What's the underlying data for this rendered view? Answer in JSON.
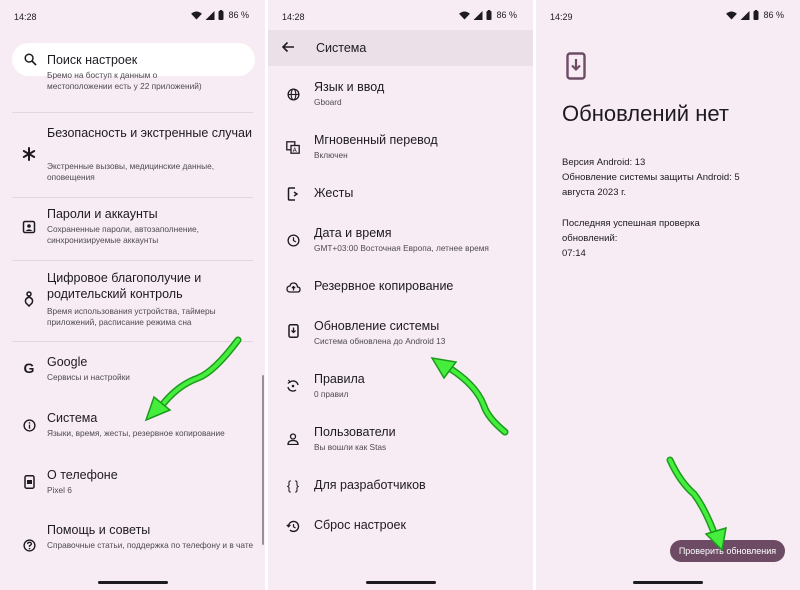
{
  "status": {
    "time1": "14:28",
    "time2": "14:28",
    "time3": "14:29",
    "battery": "86 %"
  },
  "settings": {
    "search_placeholder": "Поиск настроек",
    "clipped_line1": "Бремо на боступ к данным о",
    "clipped_line2": "местоположении есть у 22 приложений)",
    "items": [
      {
        "title": "Безопасность и экстренные случаи",
        "subtitle": "Экстренные вызовы, медицинские данные, оповещения",
        "icon": "asterisk-icon"
      },
      {
        "title": "Пароли и аккаунты",
        "subtitle": "Сохраненные пароли, автозаполнение, синхронизируемые аккаунты",
        "icon": "account-box-icon"
      },
      {
        "title": "Цифровое благополучие и родительский контроль",
        "subtitle": "Время использования устройства, таймеры приложений, расписание режима сна",
        "icon": "wellbeing-icon"
      },
      {
        "title": "Google",
        "subtitle": "Сервисы и настройки",
        "icon": "google-icon"
      },
      {
        "title": "Система",
        "subtitle": "Языки, время, жесты, резервное копирование",
        "icon": "info-icon"
      },
      {
        "title": "О телефоне",
        "subtitle": "Pixel 6",
        "icon": "phone-icon"
      },
      {
        "title": "Помощь и советы",
        "subtitle": "Справочные статьи, поддержка по телефону и в чате",
        "icon": "help-icon"
      }
    ]
  },
  "system": {
    "title": "Система",
    "items": [
      {
        "title": "Язык и ввод",
        "subtitle": "Gboard",
        "icon": "globe-icon"
      },
      {
        "title": "Мгновенный перевод",
        "subtitle": "Включен",
        "icon": "translate-icon"
      },
      {
        "title": "Жесты",
        "subtitle": "",
        "icon": "gesture-phone-icon"
      },
      {
        "title": "Дата и время",
        "subtitle": "GMT+03:00 Восточная Европа, летнее время",
        "icon": "clock-icon"
      },
      {
        "title": "Резервное копирование",
        "subtitle": "",
        "icon": "cloud-upload-icon"
      },
      {
        "title": "Обновление системы",
        "subtitle": "Система обновлена до Android 13",
        "icon": "system-update-icon"
      },
      {
        "title": "Правила",
        "subtitle": "0 правил",
        "icon": "rules-icon"
      },
      {
        "title": "Пользователи",
        "subtitle": "Вы вошли как Stas",
        "icon": "person-icon"
      },
      {
        "title": "Для разработчиков",
        "subtitle": "",
        "icon": "braces-icon"
      },
      {
        "title": "Сброс настроек",
        "subtitle": "",
        "icon": "history-icon"
      }
    ]
  },
  "update": {
    "heading": "Обновлений нет",
    "android_version": "Версия Android: 13",
    "security_line1": "Обновление системы защиты Android: 5",
    "security_line2": "августа 2023 г.",
    "last_check_line1": "Последняя успешная проверка",
    "last_check_line2": "обновлений:",
    "last_check_time": "07:14",
    "button_label": "Проверить обновления"
  },
  "colors": {
    "panel_bg": "#f7ecf3",
    "header_bg": "#ebe0e8",
    "button_bg": "#6d4b65",
    "arrow": "#39e03a"
  }
}
